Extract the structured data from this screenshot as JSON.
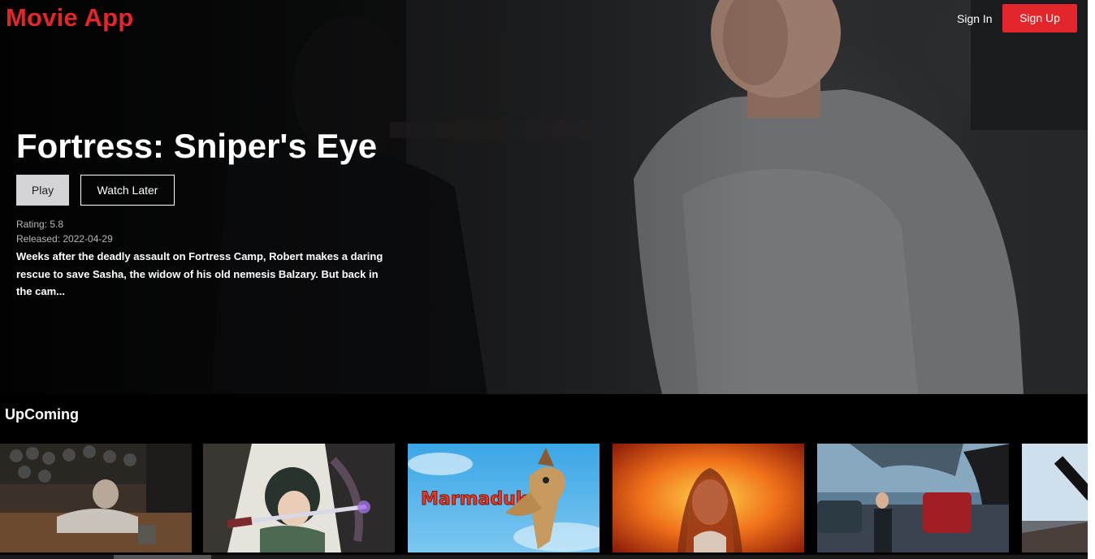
{
  "header": {
    "logo": "Movie App",
    "sign_in": "Sign In",
    "sign_up": "Sign Up"
  },
  "hero": {
    "title": "Fortress: Sniper's Eye",
    "play_label": "Play",
    "watch_later_label": "Watch Later",
    "rating": "Rating: 5.8",
    "released": "Released: 2022-04-29",
    "overview": "Weeks after the deadly assault on Fortress Camp, Robert makes a daring rescue to save Sasha, the widow of his old nemesis Balzary. But back in the cam..."
  },
  "upcoming": {
    "title": "UpComing",
    "marmaduke_logo": "Marmaduke"
  },
  "colors": {
    "accent": "#e3262b",
    "background": "#000000",
    "play_button": "#d4d4d6"
  }
}
